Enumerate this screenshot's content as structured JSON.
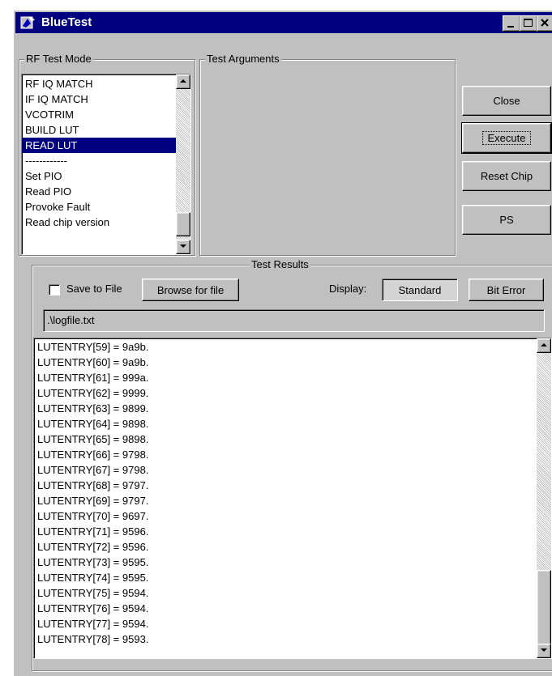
{
  "window": {
    "title": "BlueTest",
    "app_icon": "bluetooth-app-icon",
    "title_buttons": [
      "minimize",
      "maximize",
      "close"
    ]
  },
  "rf_test_mode": {
    "legend": "RF Test Mode",
    "items": [
      "RF IQ MATCH",
      "IF IQ MATCH",
      "VCOTRIM",
      "BUILD LUT",
      "READ LUT",
      "------------",
      "Set PIO",
      "Read PIO",
      "Provoke Fault",
      "Read chip version"
    ],
    "selected": "READ LUT"
  },
  "test_arguments": {
    "legend": "Test Arguments"
  },
  "buttons": {
    "close": "Close",
    "execute": "Execute",
    "reset_chip": "Reset Chip",
    "ps": "PS"
  },
  "test_results": {
    "legend": "Test Results",
    "save_to_file": {
      "label": "Save to File",
      "checked": false
    },
    "browse": "Browse for file",
    "display_label": "Display:",
    "standard": "Standard",
    "bit_error": "Bit Error",
    "file_path": ".\\logfile.txt",
    "log_lines": [
      "LUTENTRY[59] = 9a9b.",
      "LUTENTRY[60] = 9a9b.",
      "LUTENTRY[61] = 999a.",
      "LUTENTRY[62] = 9999.",
      "LUTENTRY[63] = 9899.",
      "LUTENTRY[64] = 9898.",
      "LUTENTRY[65] = 9898.",
      "LUTENTRY[66] = 9798.",
      "LUTENTRY[67] = 9798.",
      "LUTENTRY[68] = 9797.",
      "LUTENTRY[69] = 9797.",
      "LUTENTRY[70] = 9697.",
      "LUTENTRY[71] = 9596.",
      "LUTENTRY[72] = 9596.",
      "LUTENTRY[73] = 9595.",
      "LUTENTRY[74] = 9595.",
      "LUTENTRY[75] = 9594.",
      "LUTENTRY[76] = 9594.",
      "LUTENTRY[77] = 9594.",
      "LUTENTRY[78] = 9593."
    ]
  },
  "colors": {
    "titlebar": "#000080",
    "face": "#c0c0c0",
    "selection": "#000080"
  }
}
